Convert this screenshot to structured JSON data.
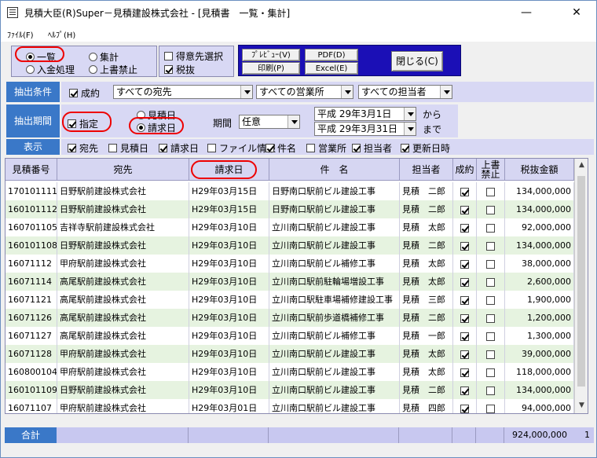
{
  "window": {
    "title": "見積大臣(R)Super－見積建設株式会社 - [見積書　一覧・集計]",
    "minimize": "—",
    "maximize": "☐",
    "close": "✕"
  },
  "menu": {
    "file": "ﾌｧｲﾙ(F)",
    "help": "ﾍﾙﾌﾟ(H)"
  },
  "mode": {
    "list": "一覧",
    "summary": "集計",
    "deposit": "入金処理",
    "overwrite_block": "上書禁止"
  },
  "options": {
    "client_select": "得意先選択",
    "tax_excluded": "税抜"
  },
  "actions": {
    "preview": "ﾌﾟﾚﾋﾞｭｰ(V)",
    "pdf": "PDF(D)",
    "print": "印刷(P)",
    "excel": "Excel(E)",
    "close": "閉じる(C)"
  },
  "filter": {
    "label": "抽出条件",
    "status_checkbox": "成約",
    "client": "すべての宛先",
    "office": "すべての営業所",
    "staff": "すべての担当者"
  },
  "period": {
    "label": "抽出期間",
    "specify": "指定",
    "estimate_date": "見積日",
    "invoice_date": "請求日",
    "period_label": "期間",
    "period_value": "任意",
    "from_date": "平成 29年3月1日",
    "to_date": "平成 29年3月31日",
    "from_suffix": "から",
    "to_suffix": "まで"
  },
  "display": {
    "label": "表示",
    "columns": [
      {
        "label": "宛先",
        "checked": true
      },
      {
        "label": "見積日",
        "checked": false
      },
      {
        "label": "請求日",
        "checked": true
      },
      {
        "label": "ファイル情報",
        "checked": false
      },
      {
        "label": "件名",
        "checked": true
      },
      {
        "label": "営業所",
        "checked": false
      },
      {
        "label": "担当者",
        "checked": true
      },
      {
        "label": "更新日時",
        "checked": true
      }
    ]
  },
  "table": {
    "headers": {
      "estimate_no": "見積番号",
      "client": "宛先",
      "invoice_date": "請求日",
      "subject": "件　名",
      "staff": "担当者",
      "contracted": "成約",
      "overwrite_block_line1": "上書",
      "overwrite_block_line2": "禁止",
      "amount": "税抜金額"
    },
    "rows": [
      {
        "no": "170101111",
        "client": "日野駅前建設株式会社",
        "date": "H29年03月15日",
        "subject": "日野南口駅前ビル建設工事",
        "staff": "見積　二郎",
        "contracted": true,
        "locked": false,
        "amount": "134,000,000"
      },
      {
        "no": "160101112",
        "client": "日野駅前建設株式会社",
        "date": "H29年03月15日",
        "subject": "日野南口駅前ビル建設工事",
        "staff": "見積　二郎",
        "contracted": true,
        "locked": false,
        "amount": "134,000,000"
      },
      {
        "no": "160701105",
        "client": "吉祥寺駅前建設株式会社",
        "date": "H29年03月10日",
        "subject": "立川南口駅前ビル建設工事",
        "staff": "見積　太郎",
        "contracted": true,
        "locked": false,
        "amount": "92,000,000"
      },
      {
        "no": "160101108",
        "client": "日野駅前建設株式会社",
        "date": "H29年03月10日",
        "subject": "立川南口駅前ビル建設工事",
        "staff": "見積　二郎",
        "contracted": true,
        "locked": false,
        "amount": "134,000,000"
      },
      {
        "no": "16071112",
        "client": "甲府駅前建設株式会社",
        "date": "H29年03月10日",
        "subject": "立川南口駅前ビル補修工事",
        "staff": "見積　太郎",
        "contracted": true,
        "locked": false,
        "amount": "38,000,000"
      },
      {
        "no": "16071114",
        "client": "高尾駅前建設株式会社",
        "date": "H29年03月10日",
        "subject": "立川南口駅前駐輪場増設工事",
        "staff": "見積　太郎",
        "contracted": true,
        "locked": false,
        "amount": "2,600,000"
      },
      {
        "no": "16071121",
        "client": "高尾駅前建設株式会社",
        "date": "H29年03月10日",
        "subject": "立川南口駅駐車場補修建設工事",
        "staff": "見積　三郎",
        "contracted": true,
        "locked": false,
        "amount": "1,900,000"
      },
      {
        "no": "16071126",
        "client": "高尾駅前建設株式会社",
        "date": "H29年03月10日",
        "subject": "立川南口駅前歩道橋補修工事",
        "staff": "見積　二郎",
        "contracted": true,
        "locked": false,
        "amount": "1,200,000"
      },
      {
        "no": "16071127",
        "client": "高尾駅前建設株式会社",
        "date": "H29年03月10日",
        "subject": "立川南口駅前ビル補修工事",
        "staff": "見積　一郎",
        "contracted": true,
        "locked": false,
        "amount": "1,300,000"
      },
      {
        "no": "16071128",
        "client": "甲府駅前建設株式会社",
        "date": "H29年03月10日",
        "subject": "立川南口駅前ビル建設工事",
        "staff": "見積　太郎",
        "contracted": true,
        "locked": false,
        "amount": "39,000,000"
      },
      {
        "no": "160800104",
        "client": "甲府駅前建設株式会社",
        "date": "H29年03月10日",
        "subject": "立川南口駅前ビル建設工事",
        "staff": "見積　太郎",
        "contracted": true,
        "locked": false,
        "amount": "118,000,000"
      },
      {
        "no": "160101109",
        "client": "日野駅前建設株式会社",
        "date": "H29年03月10日",
        "subject": "立川南口駅前ビル建設工事",
        "staff": "見積　二郎",
        "contracted": true,
        "locked": false,
        "amount": "134,000,000"
      },
      {
        "no": "16071107",
        "client": "甲府駅前建設株式会社",
        "date": "H29年03月01日",
        "subject": "立川南口駅前ビル建設工事",
        "staff": "見積　四郎",
        "contracted": true,
        "locked": false,
        "amount": "94,000,000"
      }
    ]
  },
  "totals": {
    "label": "合計",
    "amount": "924,000,000",
    "extra": "1"
  },
  "colors": {
    "accent_blue": "#3a78c8",
    "action_panel": "#1b0fb6",
    "panel_lavender": "#d8d8f4",
    "row_alt": "#e6f3e0",
    "highlight_ring": "#e00000"
  }
}
